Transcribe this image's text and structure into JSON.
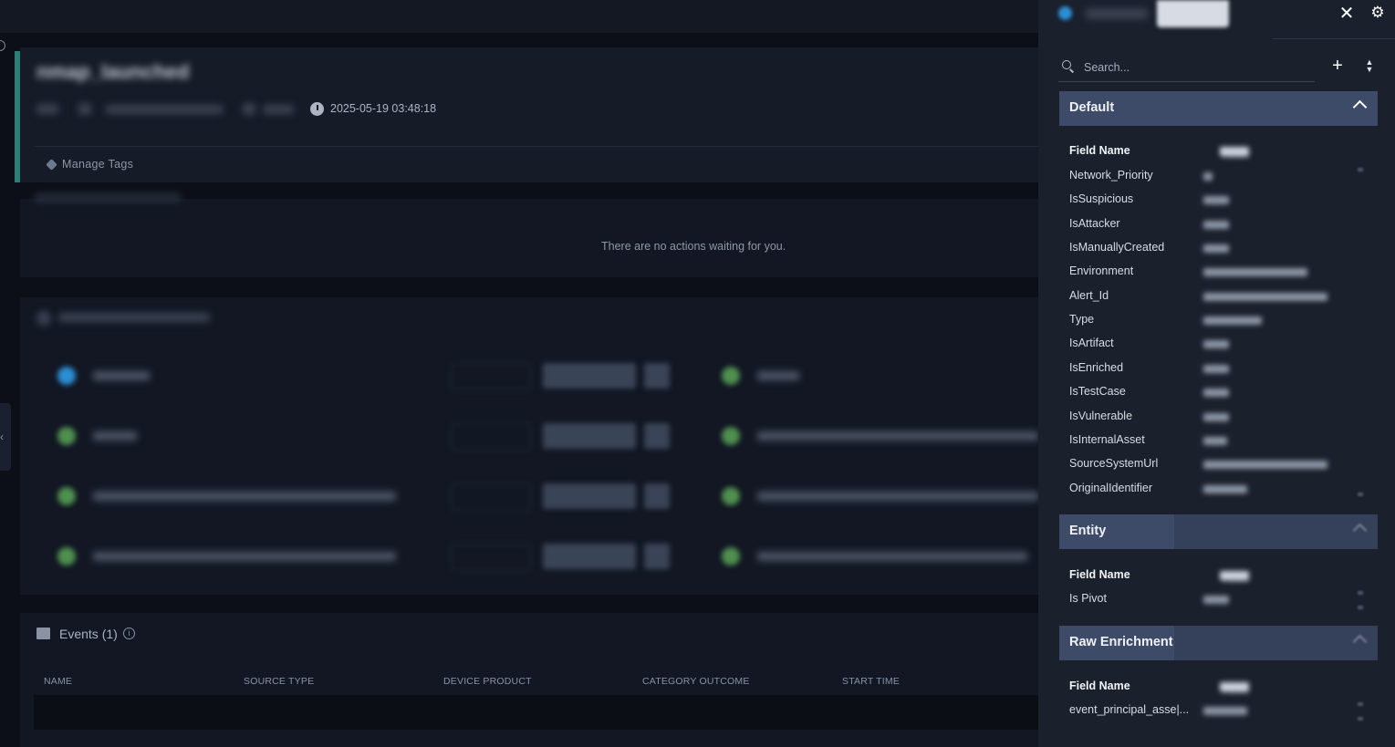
{
  "case": {
    "title": "nmap_launched",
    "date": "2025-05-19 03:48:18",
    "manage_tags_label": "Manage Tags"
  },
  "actions": {
    "empty_text": "There are no actions waiting for you."
  },
  "events": {
    "title": "Events (1)",
    "columns": [
      "NAME",
      "SOURCE TYPE",
      "DEVICE PRODUCT",
      "CATEGORY OUTCOME",
      "START TIME"
    ]
  },
  "side_panel": {
    "search_placeholder": "Search...",
    "sections": [
      {
        "title": "Default",
        "header": {
          "field": "Field Name",
          "value": "Value"
        },
        "fields": [
          "Network_Priority",
          "IsSuspicious",
          "IsAttacker",
          "IsManuallyCreated",
          "Environment",
          "Alert_Id",
          "Type",
          "IsArtifact",
          "IsEnriched",
          "IsTestCase",
          "IsVulnerable",
          "IsInternalAsset",
          "SourceSystemUrl",
          "OriginalIdentifier"
        ]
      },
      {
        "title": "Entity",
        "header": {
          "field": "Field Name",
          "value": "Value"
        },
        "fields": [
          "Is Pivot"
        ]
      },
      {
        "title": "Raw Enrichment",
        "header": {
          "field": "Field Name",
          "value": "Value"
        },
        "fields": [
          "event_principal_asse|..."
        ]
      }
    ]
  },
  "colors": {
    "accent_teal": "#2b7f77",
    "section_header": "#3e4b68",
    "panel_bg": "#1a202c",
    "page_bg": "#0c0f17"
  }
}
